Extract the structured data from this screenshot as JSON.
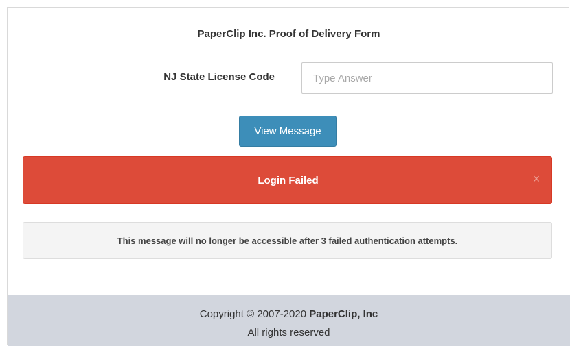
{
  "form": {
    "title": "PaperClip Inc. Proof of Delivery Form",
    "license_label": "NJ State License Code",
    "license_input_value": "",
    "license_input_placeholder": "Type Answer",
    "view_button_label": "View Message"
  },
  "error_alert": {
    "message": "Login Failed",
    "close_symbol": "×",
    "color": "#dd4b39"
  },
  "info_alert": {
    "message": "This message will no longer be accessible after 3 failed authentication attempts."
  },
  "footer": {
    "copyright_prefix": "Copyright © 2007-2020",
    "company": "PaperClip, Inc",
    "rights": "All rights reserved"
  },
  "colors": {
    "primary_button": "#3d8eb9",
    "footer_bg": "#d2d6de"
  }
}
